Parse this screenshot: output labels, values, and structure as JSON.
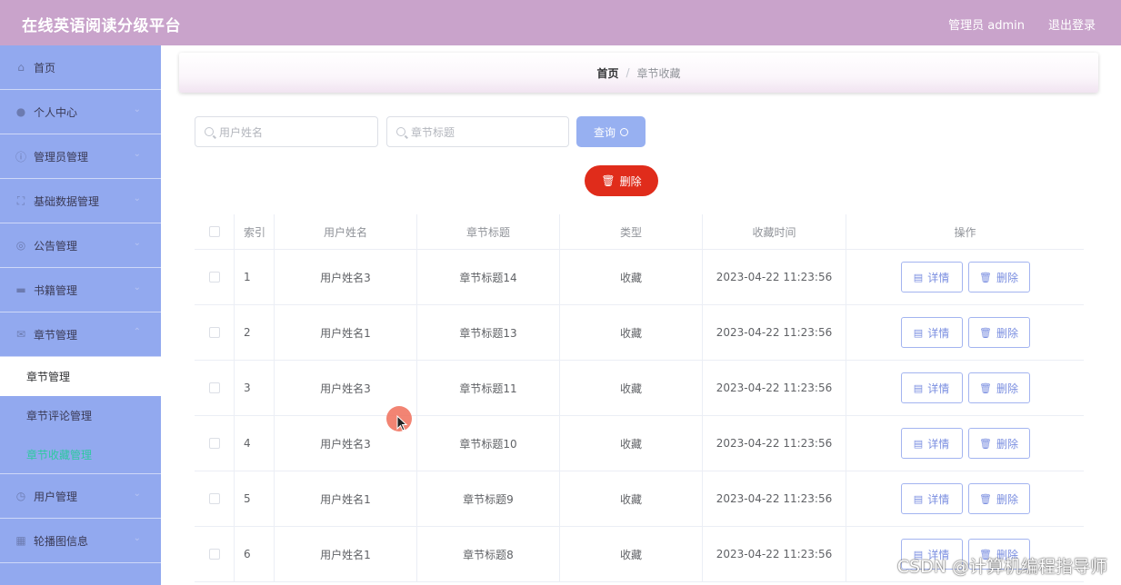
{
  "header": {
    "title": "在线英语阅读分级平台",
    "user": "管理员 admin",
    "logout": "退出登录"
  },
  "sidebar": {
    "items": [
      {
        "label": "首页",
        "icon": "home-icon"
      },
      {
        "label": "个人中心",
        "icon": "user-icon"
      },
      {
        "label": "管理员管理",
        "icon": "info-icon"
      },
      {
        "label": "基础数据管理",
        "icon": "fullscreen-icon"
      },
      {
        "label": "公告管理",
        "icon": "compass-icon"
      },
      {
        "label": "书籍管理",
        "icon": "monitor-icon"
      },
      {
        "label": "章节管理",
        "icon": "mail-icon"
      }
    ],
    "sub_items": [
      {
        "label": "章节管理"
      },
      {
        "label": "章节评论管理"
      },
      {
        "label": "章节收藏管理"
      }
    ],
    "bottom_items": [
      {
        "label": "用户管理",
        "icon": "clock-icon"
      },
      {
        "label": "轮播图信息",
        "icon": "chart-icon"
      }
    ]
  },
  "breadcrumb": {
    "home": "首页",
    "separator": "/",
    "current": "章节收藏"
  },
  "search": {
    "name_placeholder": "用户姓名",
    "title_placeholder": "章节标题",
    "query_label": "查询"
  },
  "actions": {
    "delete_label": "删除"
  },
  "table": {
    "headers": {
      "index": "索引",
      "name": "用户姓名",
      "title": "章节标题",
      "type": "类型",
      "time": "收藏时间",
      "ops": "操作"
    },
    "rows": [
      {
        "index": "1",
        "name": "用户姓名3",
        "title": "章节标题14",
        "type": "收藏",
        "time": "2023-04-22 11:23:56"
      },
      {
        "index": "2",
        "name": "用户姓名1",
        "title": "章节标题13",
        "type": "收藏",
        "time": "2023-04-22 11:23:56"
      },
      {
        "index": "3",
        "name": "用户姓名3",
        "title": "章节标题11",
        "type": "收藏",
        "time": "2023-04-22 11:23:56"
      },
      {
        "index": "4",
        "name": "用户姓名3",
        "title": "章节标题10",
        "type": "收藏",
        "time": "2023-04-22 11:23:56"
      },
      {
        "index": "5",
        "name": "用户姓名1",
        "title": "章节标题9",
        "type": "收藏",
        "time": "2023-04-22 11:23:56"
      },
      {
        "index": "6",
        "name": "用户姓名1",
        "title": "章节标题8",
        "type": "收藏",
        "time": "2023-04-22 11:23:56"
      }
    ],
    "detail_label": "详情",
    "row_delete_label": "删除"
  },
  "watermark": "CSDN @计算机编程指导师",
  "colors": {
    "topbar": "#c9a3cb",
    "sidebar": "#92a9ef",
    "delete": "#e02c1b",
    "query": "#97b0f1",
    "active_sub": "#2dc9a0"
  }
}
